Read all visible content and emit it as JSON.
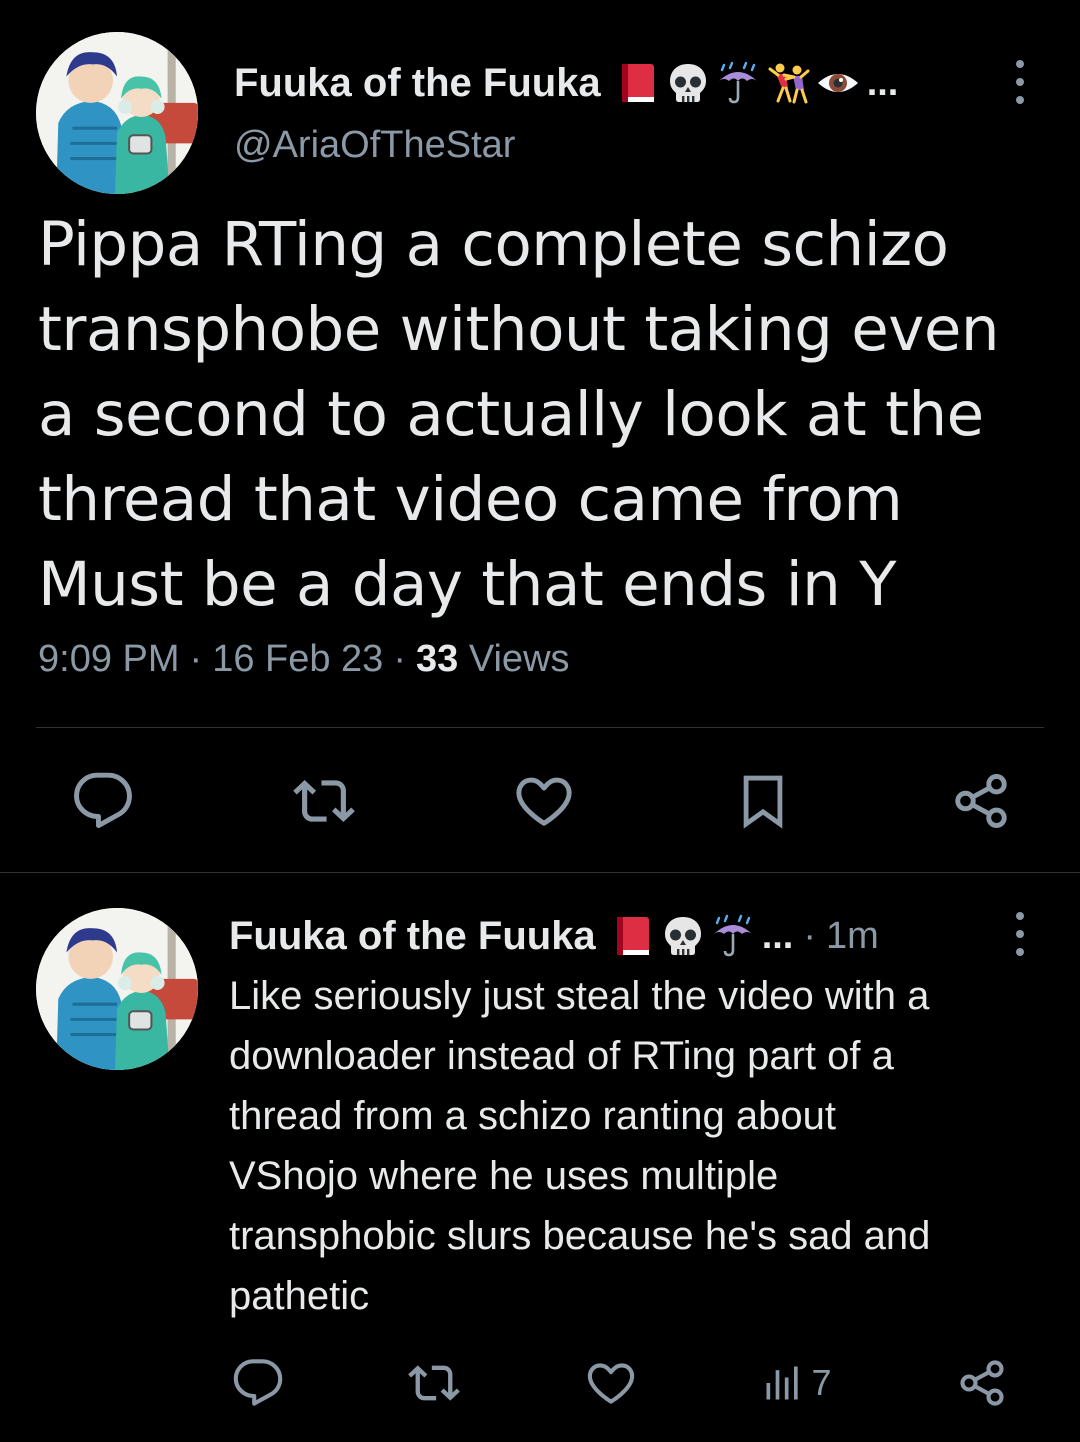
{
  "main_tweet": {
    "display_name": "Fuuka of the Fuuka",
    "name_emojis": [
      "book-emoji",
      "skull-emoji",
      "umbrella-rain-emoji",
      "dancing-people-emoji",
      "eye-emoji"
    ],
    "name_overflow": "...",
    "handle": "@AriaOfTheStar",
    "text": "Pippa RTing a complete schizo\ntransphobe without taking even\na second to actually look at the\nthread that video came from\nMust be a day that ends in Y",
    "time": "9:09 PM",
    "separator": "·",
    "date": "16 Feb 23",
    "views_count": "33",
    "views_label": "Views",
    "actions": [
      "reply-icon",
      "retweet-icon",
      "like-icon",
      "bookmark-icon",
      "share-icon"
    ]
  },
  "reply_tweet": {
    "display_name": "Fuuka of the Fuuka",
    "name_emojis": [
      "book-emoji",
      "skull-emoji",
      "umbrella-rain-emoji"
    ],
    "name_overflow": "...",
    "separator": "·",
    "time_ago": "1m",
    "text": "Like seriously just steal the video with a\ndownloader instead of RTing part of a\nthread from a schizo ranting about\nVShojo where he uses multiple\ntransphobic slurs because he's sad and\npathetic",
    "views_count": "7",
    "actions": [
      "reply-icon",
      "retweet-icon",
      "like-icon",
      "views-icon",
      "share-icon"
    ]
  },
  "colors": {
    "background": "#000000",
    "text_primary": "#e7e9ea",
    "text_secondary": "#8b98a5",
    "divider": "#2f3336"
  }
}
